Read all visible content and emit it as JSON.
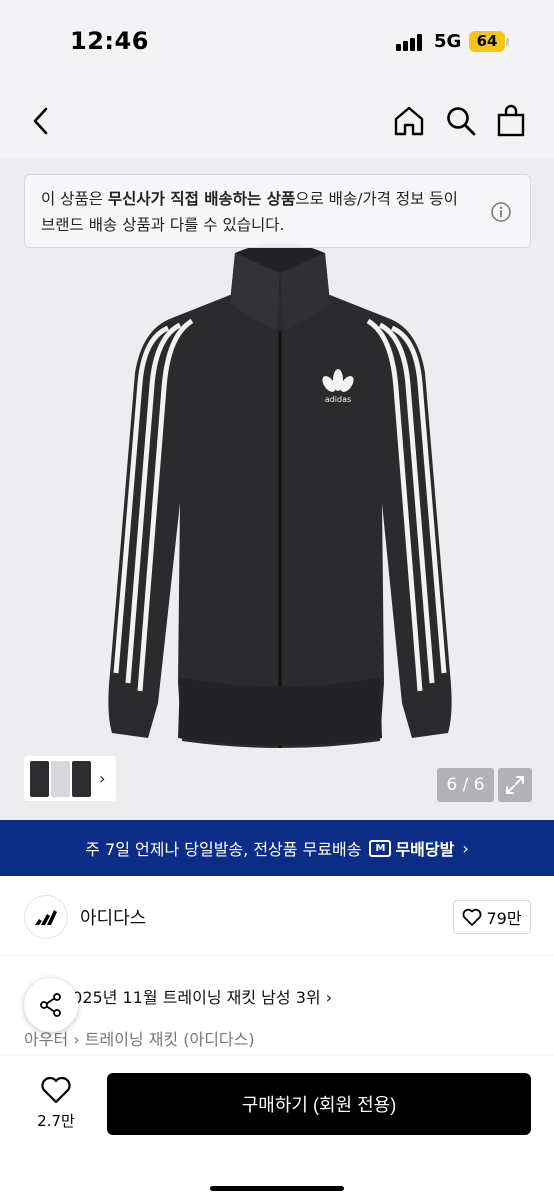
{
  "status_bar": {
    "time": "12:46",
    "network": "5G",
    "battery": "64"
  },
  "nav": {
    "icons": [
      "back-icon",
      "home-icon",
      "search-icon",
      "bag-icon"
    ]
  },
  "notice": {
    "text_prefix": "이 상품은 ",
    "text_bold": "무신사가 직접 배송하는 상품",
    "text_suffix": "으로 배송/가격 정보 등이 브랜드 배송 상품과 다를 수 있습니다."
  },
  "gallery": {
    "counter": "6 / 6",
    "logo_text": "adidas"
  },
  "promo": {
    "text": "주 7일 언제나 당일발송, 전상품 무료배송",
    "badge": "무배당발",
    "badge_icon": "M"
  },
  "brand": {
    "name": "아디다스",
    "likes": "79만"
  },
  "ranking": {
    "text": "2025년 11월 트레이닝 재킷 남성 3위"
  },
  "breadcrumb": {
    "category": "아우터",
    "subcategory": "트레이닝 재킷 (아디다스)"
  },
  "bottom_bar": {
    "wish_count": "2.7만",
    "buy_label": "구매하기 (회원 전용)"
  },
  "colors": {
    "promo_bg": "#0b2d86",
    "battery": "#f5c518",
    "buy_bg": "#000000"
  }
}
